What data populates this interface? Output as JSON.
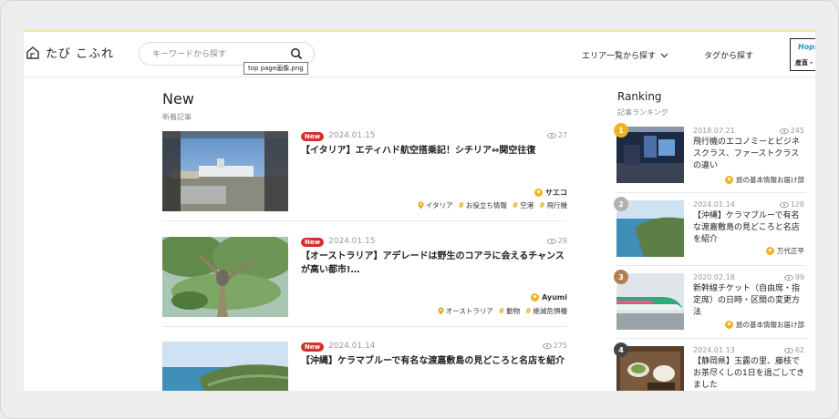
{
  "header": {
    "logo_text": "たび こふれ",
    "search_placeholder": "キーワードから探す",
    "tooltip": "top page画像.png",
    "nav_area": "エリア一覧から探す",
    "nav_tag": "タグから探す",
    "banner_top": "Hops",
    "banner_bottom": "産直・"
  },
  "new_section": {
    "title": "New",
    "subtitle": "新着記事",
    "badge": "New",
    "articles": [
      {
        "date": "2024.01.15",
        "views": "27",
        "title": "【イタリア】エティハド航空搭乗記！シチリア⇔関空往復",
        "author": "サエコ",
        "location": "イタリア",
        "tags": [
          "お役立ち情報",
          "空港",
          "飛行機"
        ]
      },
      {
        "date": "2024.01.15",
        "views": "29",
        "title": "【オーストラリア】アデレードは野生のコアラに会えるチャンスが高い都市!…",
        "author": "Ayumi",
        "location": "オーストラリア",
        "tags": [
          "動物",
          "絶滅危惧種"
        ]
      },
      {
        "date": "2024.01.14",
        "views": "275",
        "title": "【沖縄】ケラマブルーで有名な渡嘉敷島の見どころと名店を紹介"
      }
    ]
  },
  "ranking": {
    "title": "Ranking",
    "subtitle": "記事ランキング",
    "items": [
      {
        "rank": "1",
        "date": "2018.07.21",
        "views": "245",
        "title": "飛行機のエコノミーとビジネスクラス、ファーストクラスの違い",
        "author": "旅の基本情報お届け部",
        "color": "#f0b323"
      },
      {
        "rank": "2",
        "date": "2024.01.14",
        "views": "128",
        "title": "【沖縄】ケラマブルーで有名な渡嘉敷島の見どころと名店を紹介",
        "author": "万代正平",
        "color": "#b0b0b0"
      },
      {
        "rank": "3",
        "date": "2020.02.18",
        "views": "99",
        "title": "新幹線チケット（自由席・指定席）の日時・区間の変更方法",
        "author": "旅の基本情報お届け部",
        "color": "#b08050"
      },
      {
        "rank": "4",
        "date": "2024.01.13",
        "views": "62",
        "title": "【静岡県】玉露の里、藤枝でお茶尽くしの1日を過ごしてきました",
        "color": "#444444"
      }
    ]
  }
}
